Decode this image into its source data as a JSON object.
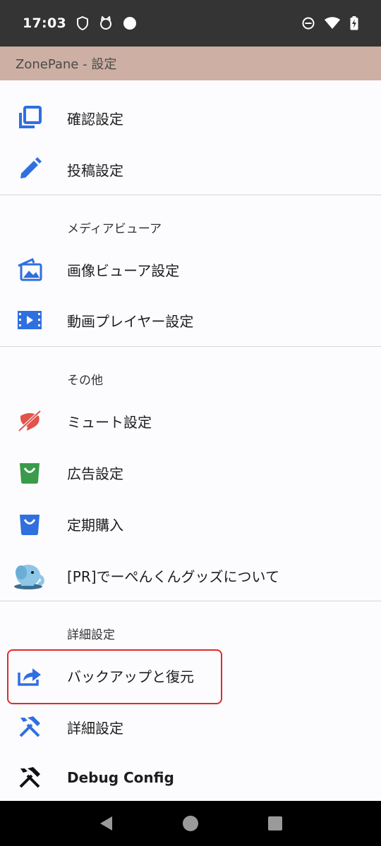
{
  "status_bar": {
    "time": "17:03",
    "left_icons": [
      "shield-icon",
      "cat-icon",
      "circle-icon"
    ],
    "right_icons": [
      "dnd-icon",
      "wifi-icon",
      "battery-charging-icon"
    ]
  },
  "app_bar": {
    "title": "ZonePane - 設定"
  },
  "items": {
    "confirm": {
      "label": "確認設定",
      "icon": "copy-icon",
      "color": "#2f6fe0"
    },
    "post": {
      "label": "投稿設定",
      "icon": "pencil-icon",
      "color": "#2f6fe0"
    },
    "image_viewer": {
      "label": "画像ビューア設定",
      "icon": "images-icon",
      "color": "#2f6fe0"
    },
    "video_player": {
      "label": "動画プレイヤー設定",
      "icon": "video-film-icon",
      "color": "#2f6fe0"
    },
    "mute": {
      "label": "ミュート設定",
      "icon": "mute-speech-icon",
      "color": "#e2534c"
    },
    "ads": {
      "label": "広告設定",
      "icon": "shopping-bag-icon",
      "color": "#3a9b4a"
    },
    "subscription": {
      "label": "定期購入",
      "icon": "shopping-bag-icon",
      "color": "#2f6fe0"
    },
    "goods": {
      "label": "[PR]でーぺんくんグッズについて",
      "icon": "elephant-mascot-icon"
    },
    "backup": {
      "label": "バックアップと復元",
      "icon": "share-export-icon",
      "color": "#2f6fe0"
    },
    "advanced": {
      "label": "詳細設定",
      "icon": "tools-icon",
      "color": "#2f6fe0"
    },
    "debug": {
      "label": "Debug Config",
      "icon": "tools-icon",
      "color": "#111111"
    }
  },
  "sections": {
    "media_viewer": "メディアビューア",
    "other": "その他",
    "advanced": "詳細設定"
  },
  "nav": [
    "back-icon",
    "home-icon",
    "recents-icon"
  ]
}
